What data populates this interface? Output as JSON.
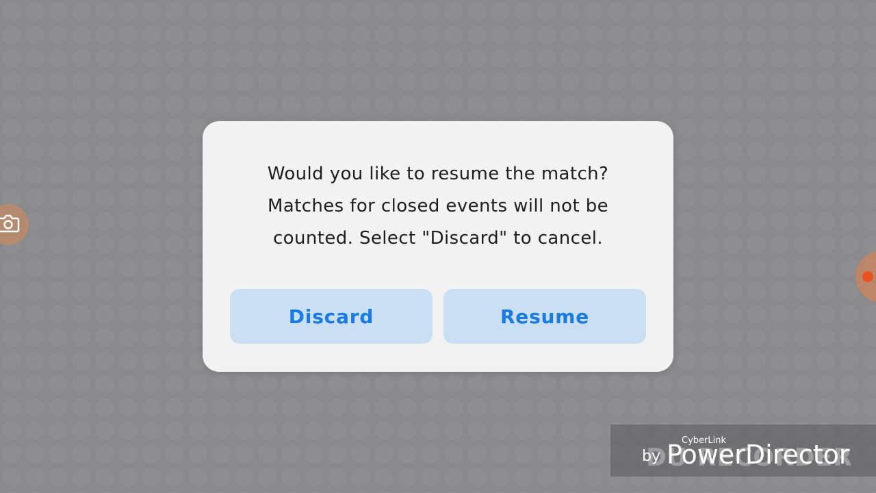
{
  "dialog": {
    "message_lines": [
      "Would you like to resume the match?",
      "Matches for closed events will not be",
      "counted. Select \"Discard\" to cancel."
    ],
    "discard_label": "Discard",
    "resume_label": "Resume"
  },
  "overlays": {
    "camera_icon": "camera-icon",
    "record_icon": "record-dot-icon"
  },
  "watermark": {
    "by": "by",
    "brand": "CyberLink",
    "product": "PowerDirector",
    "ghost_text": "DU RECORDER"
  },
  "colors": {
    "background": "#8a8a8c",
    "dialog": "#f2f2f2",
    "button_bg": "#cadff2",
    "button_text": "#1a7be0"
  }
}
